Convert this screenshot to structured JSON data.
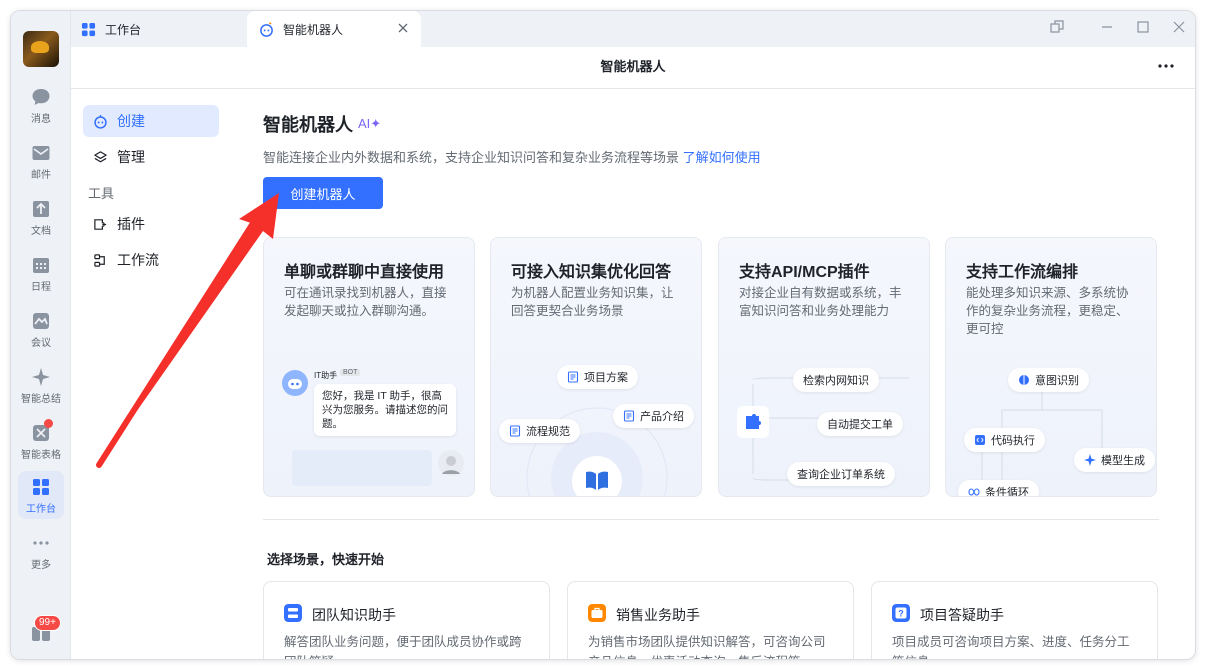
{
  "rail": {
    "items": [
      {
        "label": "消息",
        "icon": "message-icon"
      },
      {
        "label": "邮件",
        "icon": "mail-icon"
      },
      {
        "label": "文档",
        "icon": "docs-icon"
      },
      {
        "label": "日程",
        "icon": "calendar-icon"
      },
      {
        "label": "会议",
        "icon": "meeting-icon"
      },
      {
        "label": "智能总结",
        "icon": "sparkle-icon"
      },
      {
        "label": "智能表格",
        "icon": "smart-table-icon"
      },
      {
        "label": "工作台",
        "icon": "workspace-grid-icon"
      },
      {
        "label": "更多",
        "icon": "more-dots-icon"
      }
    ],
    "badge": "99+"
  },
  "tabs": {
    "home": "工作台",
    "active": "智能机器人"
  },
  "header": {
    "title": "智能机器人"
  },
  "sidenav": {
    "create": "创建",
    "manage": "管理",
    "tools_group": "工具",
    "plugin": "插件",
    "workflow": "工作流"
  },
  "main": {
    "title": "智能机器人",
    "ai_tag": "AI",
    "subtitle": "智能连接企业内外数据和系统，支持企业知识问答和复杂业务流程等场景",
    "learn_link": "了解如何使用",
    "create_button": "创建机器人"
  },
  "feature_cards": [
    {
      "title": "单聊或群聊中直接使用",
      "desc": "可在通讯录找到机器人，直接发起聊天或拉入群聊沟通。",
      "bot_name": "IT助手",
      "bot_tag": "BOT",
      "chat_text": "您好，我是 IT 助手，很高兴为您服务。请描述您的问题。"
    },
    {
      "title": "可接入知识集优化回答",
      "desc": "为机器人配置业务知识集，让回答更契合业务场景",
      "pills": [
        "项目方案",
        "产品介绍",
        "流程规范"
      ]
    },
    {
      "title": "支持API/MCP插件",
      "desc": "对接企业自有数据或系统，丰富知识问答和业务处理能力",
      "pills": [
        "检索内网知识",
        "自动提交工单",
        "查询企业订单系统"
      ]
    },
    {
      "title": "支持工作流编排",
      "desc": "能处理多知识来源、多系统协作的复杂业务流程，更稳定、更可控",
      "pills": [
        "意图识别",
        "代码执行",
        "模型生成",
        "条件循环"
      ]
    }
  ],
  "scenario": {
    "title": "选择场景，快速开始",
    "cards": [
      {
        "title": "团队知识助手",
        "desc": "解答团队业务问题，便于团队成员协作或跨团队答疑",
        "color": "#3370ff"
      },
      {
        "title": "销售业务助手",
        "desc": "为销售市场团队提供知识解答，可咨询公司产品信息、优惠活动查询、售后流程等",
        "color": "#ff8800"
      },
      {
        "title": "项目答疑助手",
        "desc": "项目成员可咨询项目方案、进度、任务分工等信息",
        "color": "#3370ff"
      }
    ]
  },
  "colors": {
    "accent": "#3370ff",
    "arrow": "#f5302a",
    "ai_purple": "#7a66f5"
  }
}
